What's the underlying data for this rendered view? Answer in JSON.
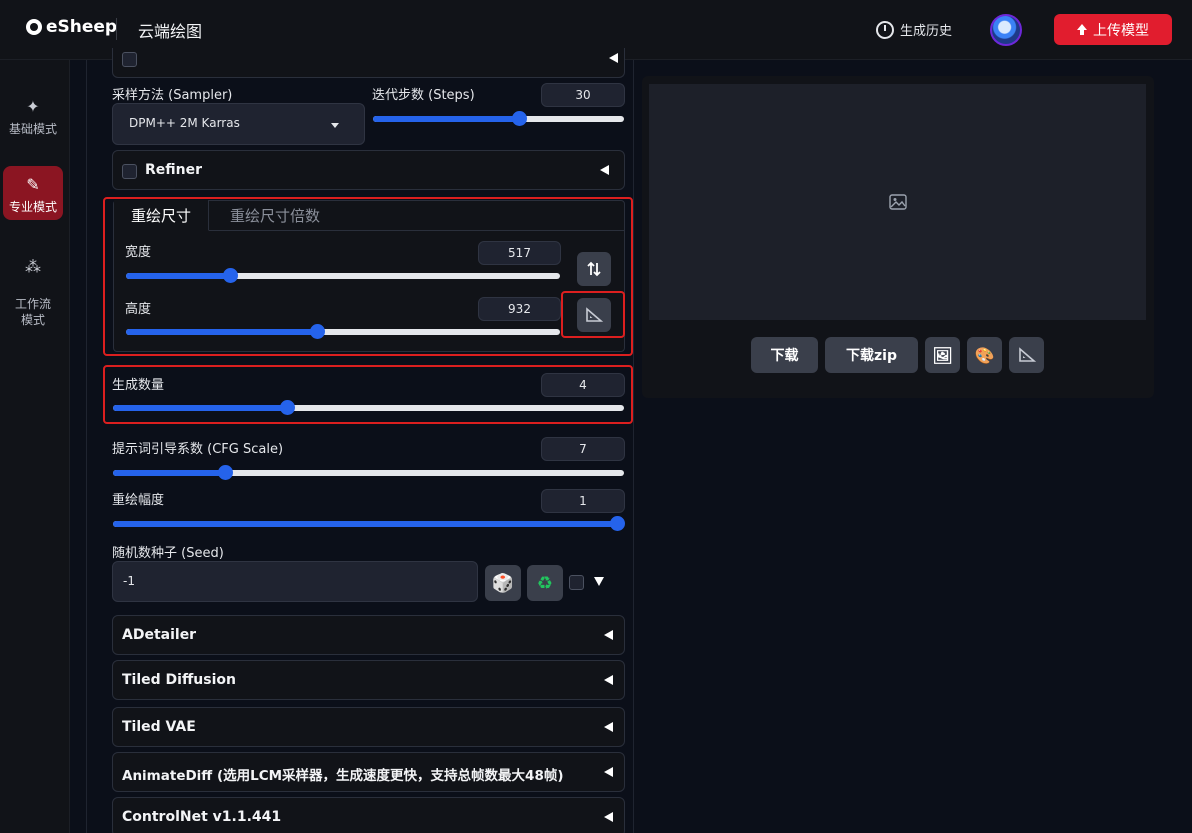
{
  "header": {
    "logo_text": "eSheep",
    "app_title": "云端绘图",
    "history_label": "生成历史",
    "upload_label": "上传模型"
  },
  "sidebar": {
    "items": [
      {
        "label": "基础模式",
        "icon": "sparkle-icon",
        "active": false
      },
      {
        "label": "专业模式",
        "icon": "brush-icon",
        "active": true
      },
      {
        "label": "工作流\n模式",
        "icon": "workflow-icon",
        "active": false
      }
    ]
  },
  "params": {
    "sampler": {
      "label": "采样方法 (Sampler)",
      "value": "DPM++ 2M Karras"
    },
    "steps": {
      "label": "迭代步数 (Steps)",
      "value": "30",
      "fraction": 0.58
    },
    "refiner": {
      "label": "Refiner",
      "checked": false
    },
    "resize": {
      "tabs": [
        "重绘尺寸",
        "重绘尺寸倍数"
      ],
      "active_tab": 0,
      "width": {
        "label": "宽度",
        "value": "517",
        "fraction": 0.24
      },
      "height": {
        "label": "高度",
        "value": "932",
        "fraction": 0.44
      }
    },
    "batch_count": {
      "label": "生成数量",
      "value": "4",
      "fraction": 0.34
    },
    "cfg": {
      "label": "提示词引导系数 (CFG Scale)",
      "value": "7",
      "fraction": 0.22
    },
    "denoise": {
      "label": "重绘幅度",
      "value": "1",
      "fraction": 1.0
    },
    "seed": {
      "label": "随机数种子 (Seed)",
      "value": "-1"
    }
  },
  "accordions": [
    "ADetailer",
    "Tiled Diffusion",
    "Tiled VAE",
    "AnimateDiff (选用LCM采样器，生成速度更快，支持总帧数最大48帧)",
    "ControlNet v1.1.441"
  ],
  "output": {
    "download_label": "下载",
    "download_zip_label": "下载zip"
  },
  "colors": {
    "accent": "#2563eb",
    "brand_red": "#e11d2e",
    "highlight": "#dc1f1f"
  }
}
